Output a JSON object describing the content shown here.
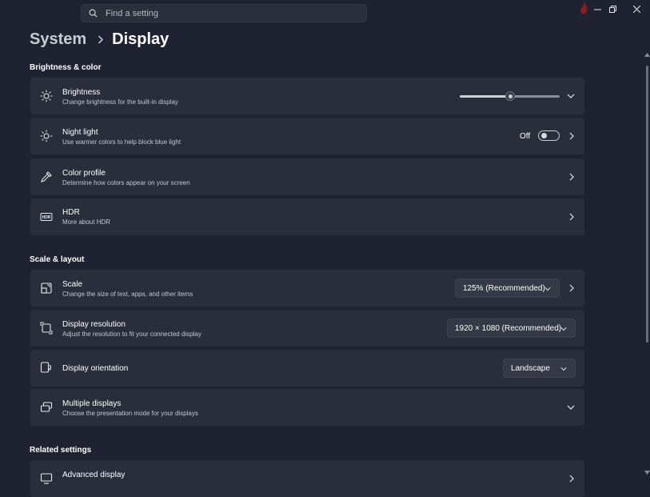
{
  "search": {
    "placeholder": "Find a setting"
  },
  "window": {
    "minimize_glyph": "—",
    "maximize_glyph": "❐",
    "close_glyph": "✕"
  },
  "breadcrumb": {
    "root": "System",
    "current": "Display"
  },
  "sections": {
    "brightness_color": "Brightness & color",
    "scale_layout": "Scale & layout",
    "related_settings": "Related settings"
  },
  "brightness": {
    "title": "Brightness",
    "subtitle": "Change brightness for the built-in display",
    "level": 0.5,
    "icon": "sun-icon"
  },
  "night_light": {
    "title": "Night light",
    "subtitle": "Use warmer colors to help block blue light",
    "state_label": "Off",
    "enabled": false,
    "icon": "moon-sun-icon"
  },
  "color_profile": {
    "title": "Color profile",
    "subtitle": "Determine how colors appear on your screen",
    "icon": "eyedropper-icon"
  },
  "hdr": {
    "title": "HDR",
    "subtitle": "More about HDR",
    "icon_text": "HDR",
    "icon": "hdr-icon"
  },
  "scale": {
    "title": "Scale",
    "subtitle": "Change the size of text, apps, and other items",
    "value": "125% (Recommended)",
    "icon": "scale-icon"
  },
  "resolution": {
    "title": "Display resolution",
    "subtitle": "Adjust the resolution to fit your connected display",
    "value": "1920 × 1080 (Recommended)",
    "icon": "resolution-icon"
  },
  "orientation": {
    "title": "Display orientation",
    "value": "Landscape",
    "icon": "orientation-icon"
  },
  "multiple_displays": {
    "title": "Multiple displays",
    "subtitle": "Choose the presentation mode for your displays",
    "icon": "multiple-displays-icon"
  },
  "advanced_display": {
    "title": "Advanced display",
    "icon": "monitor-icon"
  },
  "colors": {
    "background": "#1f2331",
    "card": "#2a2e3b",
    "slider_fill": "#cfd1d6",
    "slider_rest": "#8b8e96"
  }
}
